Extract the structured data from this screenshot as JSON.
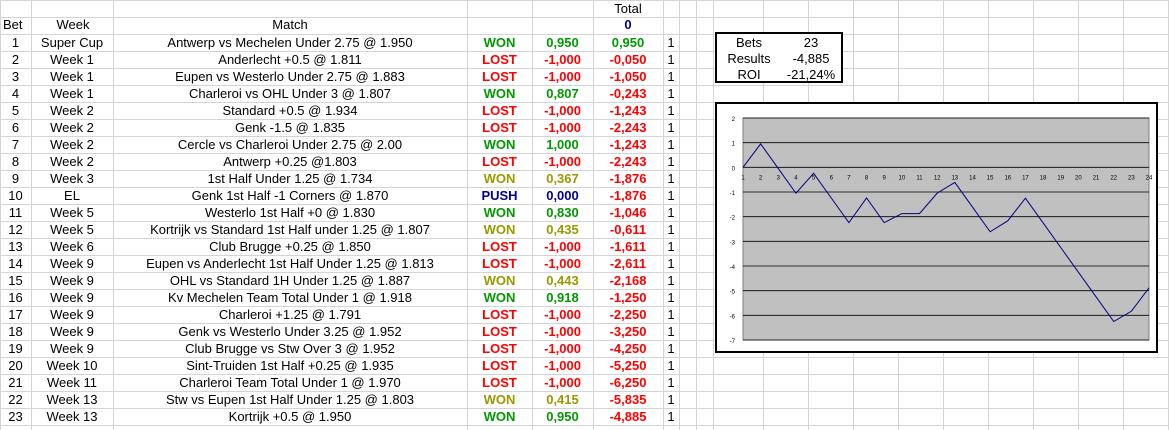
{
  "headers": {
    "bet": "Bet",
    "week": "Week",
    "match": "Match",
    "total": "Total",
    "total_value": "0"
  },
  "rows": [
    {
      "bet": "1",
      "week": "Super Cup",
      "match": "Antwerp vs Mechelen Under 2.75 @ 1.950",
      "result": "WON",
      "profit": "0,950",
      "total": "0,950",
      "units": "1",
      "style": "won"
    },
    {
      "bet": "2",
      "week": "Week 1",
      "match": "Anderlecht +0.5 @ 1.811",
      "result": "LOST",
      "profit": "-1,000",
      "total": "-0,050",
      "units": "1",
      "style": "lost"
    },
    {
      "bet": "3",
      "week": "Week 1",
      "match": "Eupen vs Westerlo Under 2.75 @ 1.883",
      "result": "LOST",
      "profit": "-1,000",
      "total": "-1,050",
      "units": "1",
      "style": "lost"
    },
    {
      "bet": "4",
      "week": "Week 1",
      "match": "Charleroi vs OHL Under 3 @ 1.807",
      "result": "WON",
      "profit": "0,807",
      "total": "-0,243",
      "units": "1",
      "style": "won"
    },
    {
      "bet": "5",
      "week": "Week 2",
      "match": "Standard +0.5 @ 1.934",
      "result": "LOST",
      "profit": "-1,000",
      "total": "-1,243",
      "units": "1",
      "style": "lost"
    },
    {
      "bet": "6",
      "week": "Week 2",
      "match": "Genk -1.5 @ 1.835",
      "result": "LOST",
      "profit": "-1,000",
      "total": "-2,243",
      "units": "1",
      "style": "lost"
    },
    {
      "bet": "7",
      "week": "Week 2",
      "match": "Cercle vs Charleroi Under 2.75 @ 2.00",
      "result": "WON",
      "profit": "1,000",
      "total": "-1,243",
      "units": "1",
      "style": "won"
    },
    {
      "bet": "8",
      "week": "Week 2",
      "match": "Antwerp +0.25 @1.803",
      "result": "LOST",
      "profit": "-1,000",
      "total": "-2,243",
      "units": "1",
      "style": "lost"
    },
    {
      "bet": "9",
      "week": "Week 3",
      "match": "1st Half Under 1.25 @ 1.734",
      "result": "WON",
      "profit": "0,367",
      "total": "-1,876",
      "units": "1",
      "style": "wony"
    },
    {
      "bet": "10",
      "week": "EL",
      "match": "Genk 1st Half -1 Corners @ 1.870",
      "result": "PUSH",
      "profit": "0,000",
      "total": "-1,876",
      "units": "1",
      "style": "push"
    },
    {
      "bet": "11",
      "week": "Week 5",
      "match": "Westerlo 1st Half +0 @ 1.830",
      "result": "WON",
      "profit": "0,830",
      "total": "-1,046",
      "units": "1",
      "style": "won"
    },
    {
      "bet": "12",
      "week": "Week 5",
      "match": "Kortrijk vs Standard 1st Half under 1.25 @ 1.807",
      "result": "WON",
      "profit": "0,435",
      "total": "-0,611",
      "units": "1",
      "style": "wony"
    },
    {
      "bet": "13",
      "week": "Week 6",
      "match": "Club Brugge +0.25 @ 1.850",
      "result": "LOST",
      "profit": "-1,000",
      "total": "-1,611",
      "units": "1",
      "style": "lost"
    },
    {
      "bet": "14",
      "week": "Week 9",
      "match": "Eupen vs Anderlecht 1st Half Under 1.25 @ 1.813",
      "result": "LOST",
      "profit": "-1,000",
      "total": "-2,611",
      "units": "1",
      "style": "lost"
    },
    {
      "bet": "15",
      "week": "Week 9",
      "match": "OHL vs Standard 1H Under 1.25 @ 1.887",
      "result": "WON",
      "profit": "0,443",
      "total": "-2,168",
      "units": "1",
      "style": "wony"
    },
    {
      "bet": "16",
      "week": "Week 9",
      "match": "Kv Mechelen Team Total Under 1 @ 1.918",
      "result": "WON",
      "profit": "0,918",
      "total": "-1,250",
      "units": "1",
      "style": "won"
    },
    {
      "bet": "17",
      "week": "Week 9",
      "match": "Charleroi +1.25 @ 1.791",
      "result": "LOST",
      "profit": "-1,000",
      "total": "-2,250",
      "units": "1",
      "style": "lost"
    },
    {
      "bet": "18",
      "week": "Week 9",
      "match": "Genk vs Westerlo Under 3.25 @ 1.952",
      "result": "LOST",
      "profit": "-1,000",
      "total": "-3,250",
      "units": "1",
      "style": "lost"
    },
    {
      "bet": "19",
      "week": "Week 9",
      "match": "Club Brugge vs Stw Over 3 @ 1.952",
      "result": "LOST",
      "profit": "-1,000",
      "total": "-4,250",
      "units": "1",
      "style": "lost"
    },
    {
      "bet": "20",
      "week": "Week 10",
      "match": "Sint-Truiden 1st Half +0.25 @ 1.935",
      "result": "LOST",
      "profit": "-1,000",
      "total": "-5,250",
      "units": "1",
      "style": "lost"
    },
    {
      "bet": "21",
      "week": "Week 11",
      "match": "Charleroi Team Total Under 1 @ 1.970",
      "result": "LOST",
      "profit": "-1,000",
      "total": "-6,250",
      "units": "1",
      "style": "lost"
    },
    {
      "bet": "22",
      "week": "Week 13",
      "match": "Stw vs Eupen 1st Half Under 1.25 @ 1.803",
      "result": "WON",
      "profit": "0,415",
      "total": "-5,835",
      "units": "1",
      "style": "wony"
    },
    {
      "bet": "23",
      "week": "Week 13",
      "match": "Kortrijk +0.5 @ 1.950",
      "result": "WON",
      "profit": "0,950",
      "total": "-4,885",
      "units": "1",
      "style": "won"
    }
  ],
  "summary": {
    "bets_label": "Bets",
    "bets_value": "23",
    "results_label": "Results",
    "results_value": "-4,885",
    "roi_label": "ROI",
    "roi_value": "-21,24%"
  },
  "colors": {
    "won": "#009900",
    "lost": "#ff0000",
    "push": "#000099",
    "won_partial": "#999900",
    "plot_bg": "#c0c0c0",
    "line": "#000080"
  },
  "chart_data": {
    "type": "line",
    "x": [
      1,
      2,
      3,
      4,
      5,
      6,
      7,
      8,
      9,
      10,
      11,
      12,
      13,
      14,
      15,
      16,
      17,
      18,
      19,
      20,
      21,
      22,
      23,
      24
    ],
    "series": [
      {
        "values": [
          0,
          0.95,
          -0.05,
          -1.05,
          -0.243,
          -1.243,
          -2.243,
          -1.243,
          -2.243,
          -1.876,
          -1.876,
          -1.046,
          -0.611,
          -1.611,
          -2.611,
          -2.168,
          -1.25,
          -2.25,
          -3.25,
          -4.25,
          -5.25,
          -6.25,
          -5.835,
          -4.885
        ]
      }
    ],
    "ylim": [
      -7,
      2
    ],
    "yticks": [
      "2",
      "1",
      "0",
      "-1",
      "-2",
      "-3",
      "-4",
      "-5",
      "-6",
      "-7"
    ],
    "xticks": [
      "1",
      "2",
      "3",
      "4",
      "5",
      "6",
      "7",
      "8",
      "9",
      "10",
      "11",
      "12",
      "13",
      "14",
      "15",
      "16",
      "17",
      "18",
      "19",
      "20",
      "21",
      "22",
      "23",
      "24"
    ],
    "grid": true
  }
}
